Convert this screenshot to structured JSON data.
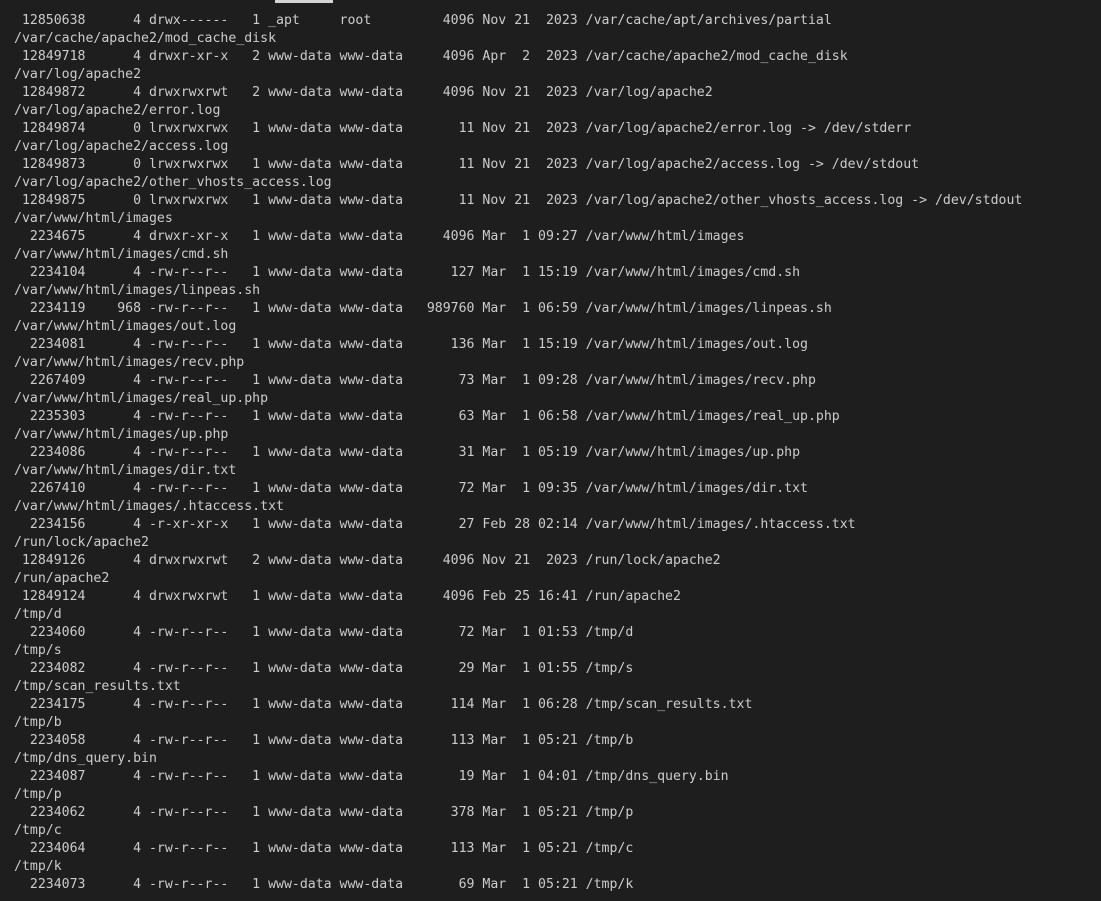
{
  "terminal": {
    "lines": [
      " 12850638      4 drwx------   1 _apt     root         4096 Nov 21  2023 /var/cache/apt/archives/partial",
      "/var/cache/apache2/mod_cache_disk",
      " 12849718      4 drwxr-xr-x   2 www-data www-data     4096 Apr  2  2023 /var/cache/apache2/mod_cache_disk",
      "/var/log/apache2",
      " 12849872      4 drwxrwxrwt   2 www-data www-data     4096 Nov 21  2023 /var/log/apache2",
      "/var/log/apache2/error.log",
      " 12849874      0 lrwxrwxrwx   1 www-data www-data       11 Nov 21  2023 /var/log/apache2/error.log -> /dev/stderr",
      "/var/log/apache2/access.log",
      " 12849873      0 lrwxrwxrwx   1 www-data www-data       11 Nov 21  2023 /var/log/apache2/access.log -> /dev/stdout",
      "/var/log/apache2/other_vhosts_access.log",
      " 12849875      0 lrwxrwxrwx   1 www-data www-data       11 Nov 21  2023 /var/log/apache2/other_vhosts_access.log -> /dev/stdout",
      "/var/www/html/images",
      "  2234675      4 drwxr-xr-x   1 www-data www-data     4096 Mar  1 09:27 /var/www/html/images",
      "/var/www/html/images/cmd.sh",
      "  2234104      4 -rw-r--r--   1 www-data www-data      127 Mar  1 15:19 /var/www/html/images/cmd.sh",
      "/var/www/html/images/linpeas.sh",
      "  2234119    968 -rw-r--r--   1 www-data www-data   989760 Mar  1 06:59 /var/www/html/images/linpeas.sh",
      "/var/www/html/images/out.log",
      "  2234081      4 -rw-r--r--   1 www-data www-data      136 Mar  1 15:19 /var/www/html/images/out.log",
      "/var/www/html/images/recv.php",
      "  2267409      4 -rw-r--r--   1 www-data www-data       73 Mar  1 09:28 /var/www/html/images/recv.php",
      "/var/www/html/images/real_up.php",
      "  2235303      4 -rw-r--r--   1 www-data www-data       63 Mar  1 06:58 /var/www/html/images/real_up.php",
      "/var/www/html/images/up.php",
      "  2234086      4 -rw-r--r--   1 www-data www-data       31 Mar  1 05:19 /var/www/html/images/up.php",
      "/var/www/html/images/dir.txt",
      "  2267410      4 -rw-r--r--   1 www-data www-data       72 Mar  1 09:35 /var/www/html/images/dir.txt",
      "/var/www/html/images/.htaccess.txt",
      "  2234156      4 -r-xr-xr-x   1 www-data www-data       27 Feb 28 02:14 /var/www/html/images/.htaccess.txt",
      "/run/lock/apache2",
      " 12849126      4 drwxrwxrwt   2 www-data www-data     4096 Nov 21  2023 /run/lock/apache2",
      "/run/apache2",
      " 12849124      4 drwxrwxrwt   1 www-data www-data     4096 Feb 25 16:41 /run/apache2",
      "/tmp/d",
      "  2234060      4 -rw-r--r--   1 www-data www-data       72 Mar  1 01:53 /tmp/d",
      "/tmp/s",
      "  2234082      4 -rw-r--r--   1 www-data www-data       29 Mar  1 01:55 /tmp/s",
      "/tmp/scan_results.txt",
      "  2234175      4 -rw-r--r--   1 www-data www-data      114 Mar  1 06:28 /tmp/scan_results.txt",
      "/tmp/b",
      "  2234058      4 -rw-r--r--   1 www-data www-data      113 Mar  1 05:21 /tmp/b",
      "/tmp/dns_query.bin",
      "  2234087      4 -rw-r--r--   1 www-data www-data       19 Mar  1 04:01 /tmp/dns_query.bin",
      "/tmp/p",
      "  2234062      4 -rw-r--r--   1 www-data www-data      378 Mar  1 05:21 /tmp/p",
      "/tmp/c",
      "  2234064      4 -rw-r--r--   1 www-data www-data      113 Mar  1 05:21 /tmp/c",
      "/tmp/k",
      "  2234073      4 -rw-r--r--   1 www-data www-data       69 Mar  1 05:21 /tmp/k"
    ]
  }
}
